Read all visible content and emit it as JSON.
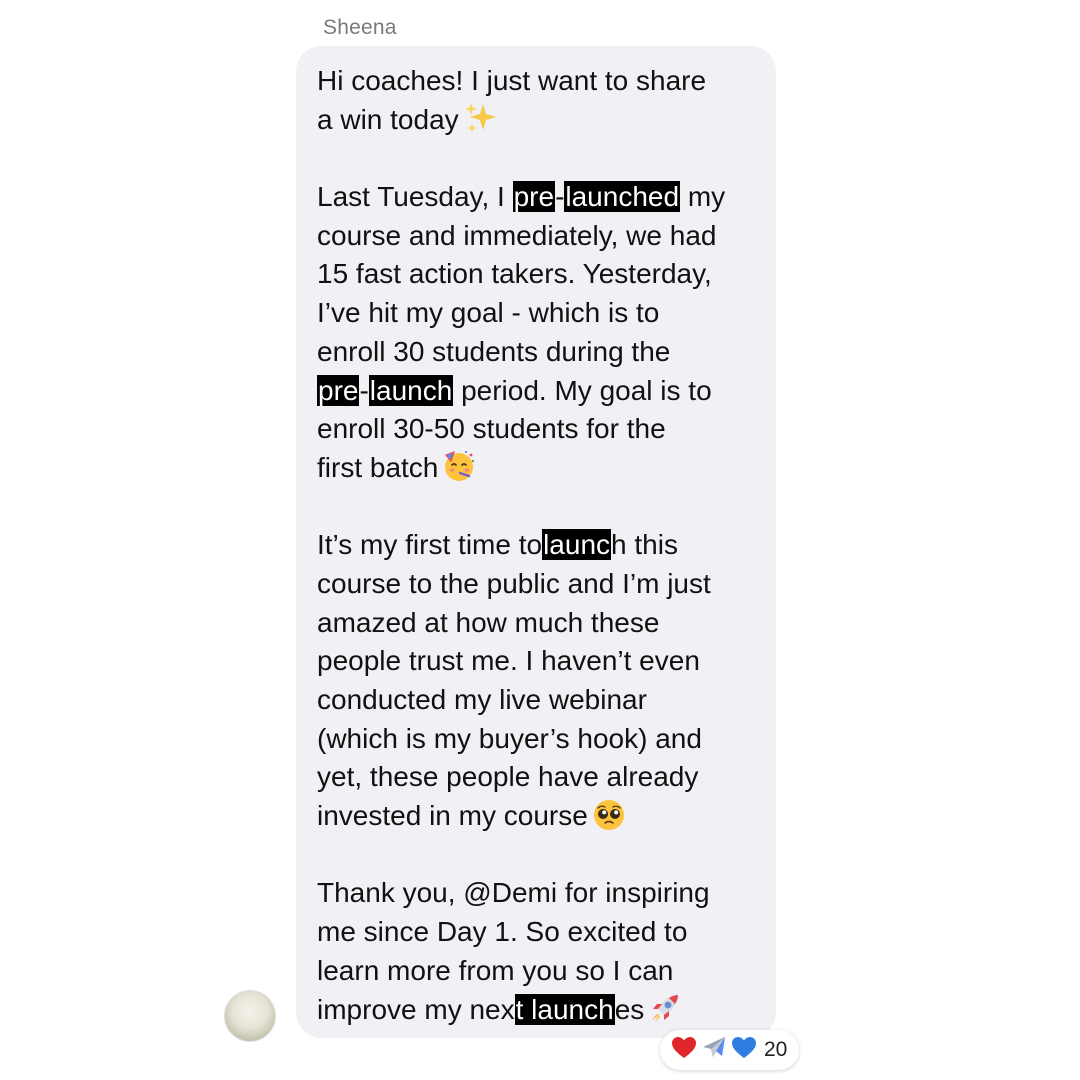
{
  "sender": {
    "name": "Sheena"
  },
  "message": {
    "p1": {
      "l1": "Hi coaches! I just want to share",
      "l2": "a win today"
    },
    "p2": {
      "l1_a": "Last Tuesday, I ",
      "l1_h1": "pre",
      "l1_b": "-",
      "l1_h2": "launched",
      "l1_c": " my",
      "l2": "course and immediately, we had",
      "l3": "15 fast action takers. Yesterday,",
      "l4": "I’ve hit my goal - which is to",
      "l5": "enroll 30 students during the",
      "l6_h1": "pre",
      "l6_a": "-",
      "l6_h2": "launch",
      "l6_b": " period. My goal is to",
      "l7": "enroll 30-50 students for the",
      "l8": "first batch"
    },
    "p3": {
      "l1_a": "It’s my first time to",
      "l1_h": "launc",
      "l1_b": "h this",
      "l2": "course to the public and I’m just",
      "l3": "amazed at how much these",
      "l4": "people trust me. I haven’t even",
      "l5": "conducted my live webinar",
      "l6": "(which is my buyer’s hook) and",
      "l7": "yet, these people have already",
      "l8": "invested in my course"
    },
    "p4": {
      "l1": "Thank you, @Demi for inspiring",
      "l2": "me since Day 1. So excited to",
      "l3": "learn more from you so I can",
      "l4_a": "improve my nex",
      "l4_h": "t launch",
      "l4_b": "es"
    },
    "emojis": [
      "sparkles-emoji",
      "partying-face-emoji",
      "pleading-face-emoji",
      "rocket-emoji"
    ]
  },
  "reactions": {
    "icons": [
      "red-heart-icon",
      "airplane-icon",
      "blue-heart-icon"
    ],
    "count": "20"
  },
  "colors": {
    "bubble": "#f0f0f5",
    "highlight": "#000000",
    "sender_name": "#7a7a7e"
  }
}
